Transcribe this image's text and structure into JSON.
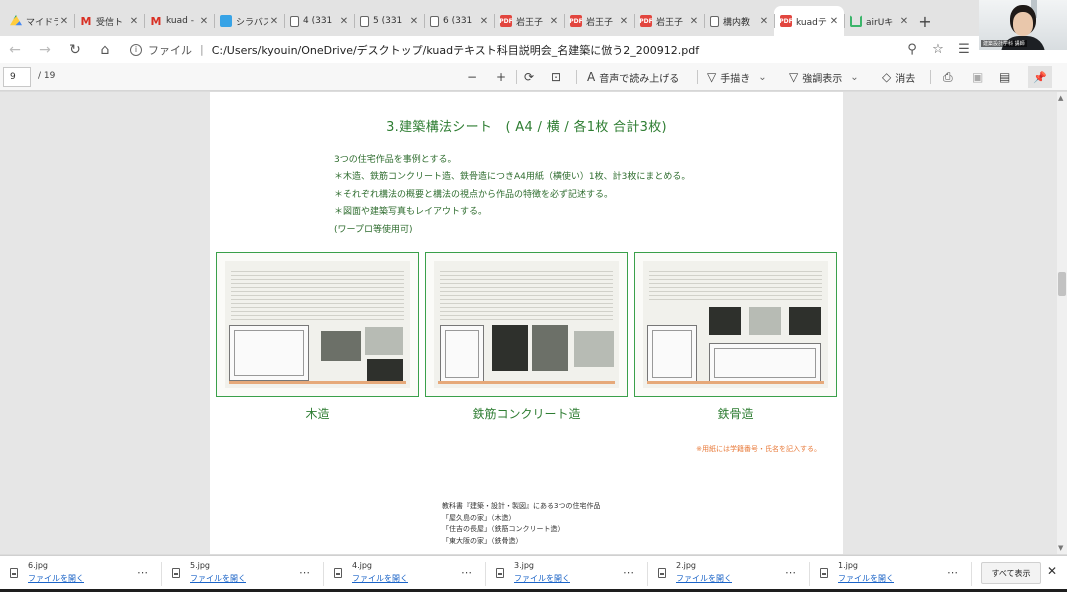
{
  "tabs": [
    {
      "label": "マイドラ",
      "favicon": "drive-icon",
      "active": false
    },
    {
      "label": "受信ト",
      "favicon": "gmail-icon",
      "active": false
    },
    {
      "label": "kuad -",
      "favicon": "gmail-icon",
      "active": false
    },
    {
      "label": "シラバス",
      "favicon": "cloud-icon",
      "active": false
    },
    {
      "label": "4 (331",
      "favicon": "doc-icon",
      "active": false
    },
    {
      "label": "5 (331",
      "favicon": "doc-icon",
      "active": false
    },
    {
      "label": "6 (331",
      "favicon": "doc-icon",
      "active": false
    },
    {
      "label": "岩王子",
      "favicon": "pdf-icon",
      "active": false
    },
    {
      "label": "岩王子",
      "favicon": "pdf-icon",
      "active": false
    },
    {
      "label": "岩王子",
      "favicon": "pdf-icon",
      "active": false
    },
    {
      "label": "構内教",
      "favicon": "doc-icon",
      "active": false
    },
    {
      "label": "kuadテ",
      "favicon": "pdf-icon",
      "active": true
    },
    {
      "label": "airUキ",
      "favicon": "air-icon",
      "active": false
    }
  ],
  "address": {
    "scheme_label": "ファイル",
    "separator": "|",
    "url": "C:/Users/kyouin/OneDrive/デスクトップ/kuadテキスト科目説明会_名建築に倣う2_200912.pdf"
  },
  "webcam": {
    "tag": "建築設計学科 講師"
  },
  "pdf_toolbar": {
    "page_current": "9",
    "page_total": "/ 19",
    "read_aloud": "音声で読み上げる",
    "draw": "手描き",
    "highlight": "強調表示",
    "erase": "消去"
  },
  "page": {
    "title": "3.建築構法シート　( A4 / 横 / 各1枚 合計3枚)",
    "lines": [
      "3つの住宅作品を事例とする。",
      "＊木造、鉄筋コンクリート造、鉄骨造につきA4用紙（横使い）1枚、計3枚にまとめる。",
      "＊それぞれ構法の概要と構法の視点から作品の特徴を必ず記述する。",
      "＊図面や建築写真もレイアウトする。",
      "(ワープロ等使用可)"
    ],
    "captions": [
      "木造",
      "鉄筋コンクリート造",
      "鉄骨造"
    ],
    "note": "※用紙には学籍番号・氏名を記入する。",
    "footnotes": [
      "教科書『建築・設計・製図』にある3つの住宅作品",
      "「屋久島の家」（木造）",
      "「住吉の長屋」（鉄筋コンクリート造）",
      "「東大阪の家」（鉄骨造）"
    ]
  },
  "downloads": {
    "items": [
      {
        "name": "6.jpg",
        "action": "ファイルを開く"
      },
      {
        "name": "5.jpg",
        "action": "ファイルを開く"
      },
      {
        "name": "4.jpg",
        "action": "ファイルを開く"
      },
      {
        "name": "3.jpg",
        "action": "ファイルを開く"
      },
      {
        "name": "2.jpg",
        "action": "ファイルを開く"
      },
      {
        "name": "1.jpg",
        "action": "ファイルを開く"
      }
    ],
    "show_all": "すべて表示",
    "more": "⋯"
  },
  "colors": {
    "accent_green": "#2e7d32",
    "note_orange": "#e87a3a",
    "link_blue": "#1a63c7"
  }
}
